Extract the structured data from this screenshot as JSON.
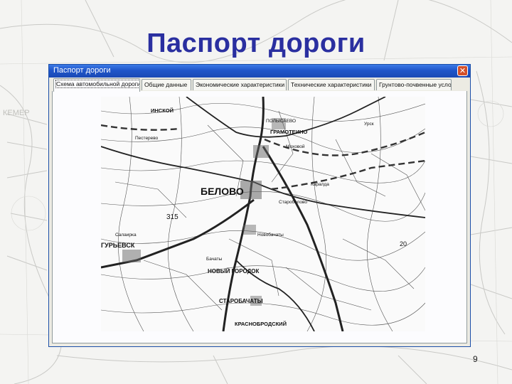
{
  "slide": {
    "title": "Паспорт дороги",
    "page_number": "9"
  },
  "window": {
    "title": "Паспорт дороги",
    "close_glyph": "✕"
  },
  "tabs": [
    {
      "label": "Схема автомобильной дороги",
      "active": true
    },
    {
      "label": "Общие данные",
      "active": false
    },
    {
      "label": "Экономические характеристики",
      "active": false
    },
    {
      "label": "Технические характеристики",
      "active": false
    },
    {
      "label": "Грунтово-почвенные условия",
      "active": false
    }
  ],
  "map": {
    "places": [
      {
        "label": "БЕЛОВО",
        "size": "large"
      },
      {
        "label": "ГУРЬЕВСК",
        "size": "medium"
      },
      {
        "label": "НОВЫЙ ГОРОДОК",
        "size": "medium"
      },
      {
        "label": "СТАРОБАЧАТЫ",
        "size": "medium"
      },
      {
        "label": "КРАСНОБРОДСКИЙ",
        "size": "medium"
      },
      {
        "label": "ИНСКОЙ",
        "size": "medium"
      },
      {
        "label": "ГРАМОТЕИНО",
        "size": "medium"
      },
      {
        "label": "ПОЛЫСАЕВО",
        "size": "small"
      },
      {
        "label": "Пестерево",
        "size": "small"
      },
      {
        "label": "Бачаты",
        "size": "small"
      },
      {
        "label": "Моховой",
        "size": "small"
      },
      {
        "label": "Каралда",
        "size": "small"
      },
      {
        "label": "Старобелово",
        "size": "small"
      },
      {
        "label": "Новобачаты",
        "size": "small"
      },
      {
        "label": "Салаирка",
        "size": "small"
      },
      {
        "label": "Урск",
        "size": "small"
      }
    ],
    "highway_numbers": [
      "315",
      "20"
    ],
    "background_labels": [
      "КЕМЕР"
    ]
  },
  "colors": {
    "title": "#2a2fa0",
    "window_border": "#1b4ea8",
    "titlebar": "#1f55c9",
    "close_button": "#d4502a",
    "window_face": "#ecebe3"
  }
}
